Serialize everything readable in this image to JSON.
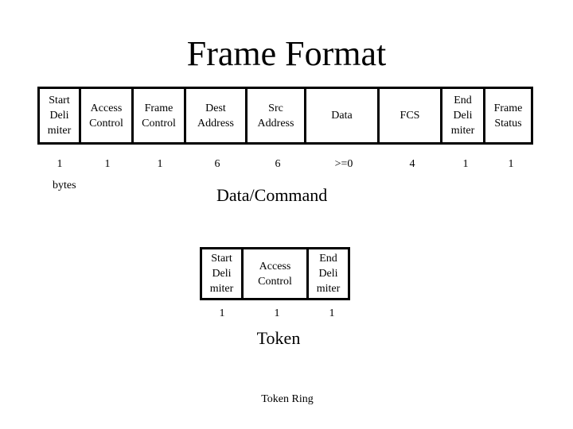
{
  "title": "Frame Format",
  "frame": {
    "fields": [
      {
        "label": "Start\nDeli\nmiter",
        "lines": [
          "Start",
          "Deli",
          "miter"
        ],
        "bytes": "1"
      },
      {
        "label": "Access Control",
        "lines": [
          "Access",
          "Control"
        ],
        "bytes": "1"
      },
      {
        "label": "Frame Control",
        "lines": [
          "Frame",
          "Control"
        ],
        "bytes": "1"
      },
      {
        "label": "Dest Address",
        "lines": [
          "Dest",
          "Address"
        ],
        "bytes": "6"
      },
      {
        "label": "Src Address",
        "lines": [
          "Src",
          "Address"
        ],
        "bytes": "6"
      },
      {
        "label": "Data",
        "lines": [
          "Data"
        ],
        "bytes": ">=0"
      },
      {
        "label": "FCS",
        "lines": [
          "FCS"
        ],
        "bytes": "4"
      },
      {
        "label": "End Deli miter",
        "lines": [
          "End",
          "Deli",
          "miter"
        ],
        "bytes": "1"
      },
      {
        "label": "Frame Status",
        "lines": [
          "Frame",
          "Status"
        ],
        "bytes": "1"
      }
    ],
    "unit_label": "bytes",
    "caption": "Data/Command"
  },
  "token": {
    "fields": [
      {
        "label": "Start Deli miter",
        "lines": [
          "Start",
          "Deli",
          "miter"
        ],
        "bytes": "1"
      },
      {
        "label": "Access Control",
        "lines": [
          "Access",
          "Control"
        ],
        "bytes": "1"
      },
      {
        "label": "End Deli miter",
        "lines": [
          "End",
          "Deli",
          "miter"
        ],
        "bytes": "1"
      }
    ],
    "caption": "Token"
  },
  "footer": "Token Ring"
}
